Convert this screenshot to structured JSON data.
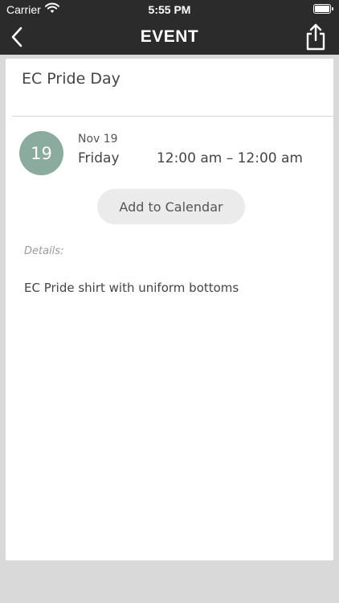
{
  "status_bar": {
    "carrier": "Carrier",
    "time": "5:55 PM",
    "icons": [
      "wifi-icon",
      "battery-icon"
    ]
  },
  "nav_bar": {
    "title": "EVENT",
    "back_icon": "chevron-left-icon",
    "share_icon": "share-icon"
  },
  "event": {
    "title": "EC Pride Day",
    "day_number": "19",
    "month_day": "Nov 19",
    "weekday": "Friday",
    "time_range": "12:00 am – 12:00 am",
    "add_to_calendar_label": "Add to Calendar",
    "details_label": "Details:",
    "details_text": "EC Pride shirt with uniform bottoms"
  },
  "colors": {
    "nav_background": "#2b2b2b",
    "page_background": "#d9d9d9",
    "day_circle": "#8aab9d",
    "button_background": "#ebebeb"
  }
}
